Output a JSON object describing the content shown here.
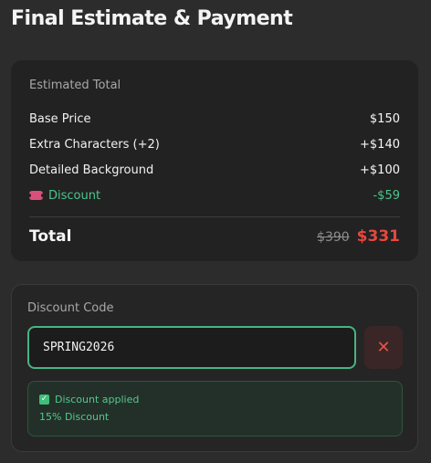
{
  "page": {
    "title": "Final Estimate & Payment"
  },
  "estimate": {
    "section_label": "Estimated Total",
    "line_items": [
      {
        "name": "Base Price",
        "amount": "$150"
      },
      {
        "name": "Extra Characters (+2)",
        "amount": "+$140"
      },
      {
        "name": "Detailed Background",
        "amount": "+$100"
      }
    ],
    "discount": {
      "name": "Discount",
      "amount": "-$59",
      "icon": "ticket-icon"
    },
    "total": {
      "label": "Total",
      "original_price": "$390",
      "final_price": "$331"
    }
  },
  "discount_code": {
    "label": "Discount Code",
    "value": "SPRING2026",
    "clear_symbol": "✕",
    "status": {
      "message": "Discount applied",
      "detail": "15% Discount",
      "icon": "check-icon"
    }
  },
  "colors": {
    "background": "#2c2c2c",
    "card": "#222222",
    "accent_green": "#4cc58c",
    "accent_red": "#e5483f"
  }
}
